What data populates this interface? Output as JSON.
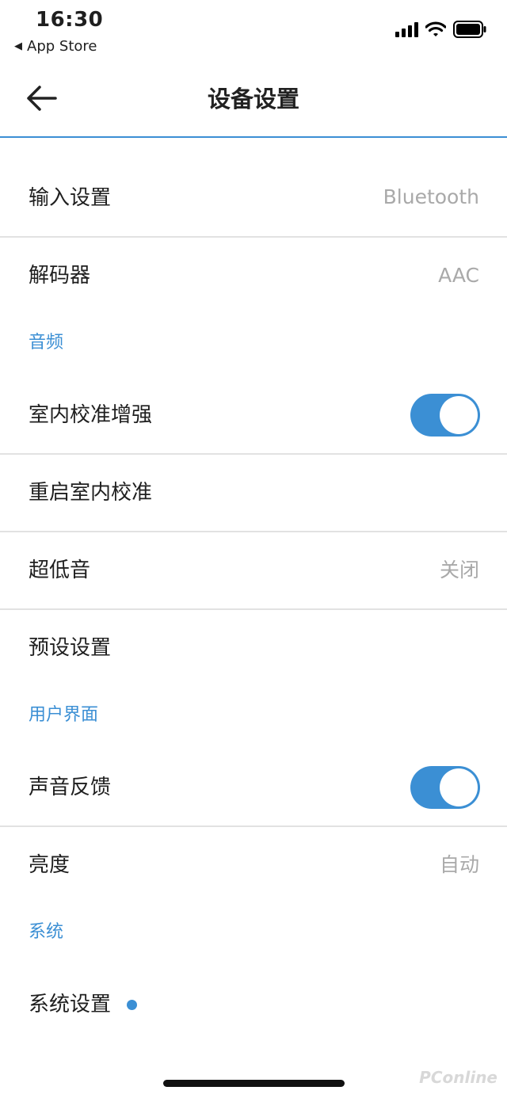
{
  "status_bar": {
    "time": "16:30",
    "back_app": "App Store",
    "icons": [
      "signal-icon",
      "wifi-icon",
      "battery-icon"
    ]
  },
  "nav": {
    "title": "设备设置",
    "back_icon": "back-arrow-icon"
  },
  "rows": {
    "input": {
      "label": "输入设置",
      "value": "Bluetooth"
    },
    "decoder": {
      "label": "解码器",
      "value": "AAC"
    },
    "audio_section": {
      "label": "音频"
    },
    "room_calibration": {
      "label": "室内校准增强",
      "toggle": true
    },
    "restart_calibration": {
      "label": "重启室内校准"
    },
    "subwoofer": {
      "label": "超低音",
      "value": "关闭"
    },
    "presets": {
      "label": "预设设置"
    },
    "ui_section": {
      "label": "用户界面"
    },
    "sound_feedback": {
      "label": "声音反馈",
      "toggle": true
    },
    "brightness": {
      "label": "亮度",
      "value": "自动"
    },
    "system_section": {
      "label": "系统"
    },
    "system_settings": {
      "label": "系统设置",
      "badge": "notification-dot"
    }
  },
  "colors": {
    "accent": "#3b8fd4",
    "divider": "#e2e2e2",
    "secondary_text": "#a9a9a9"
  },
  "watermark": "PConline"
}
